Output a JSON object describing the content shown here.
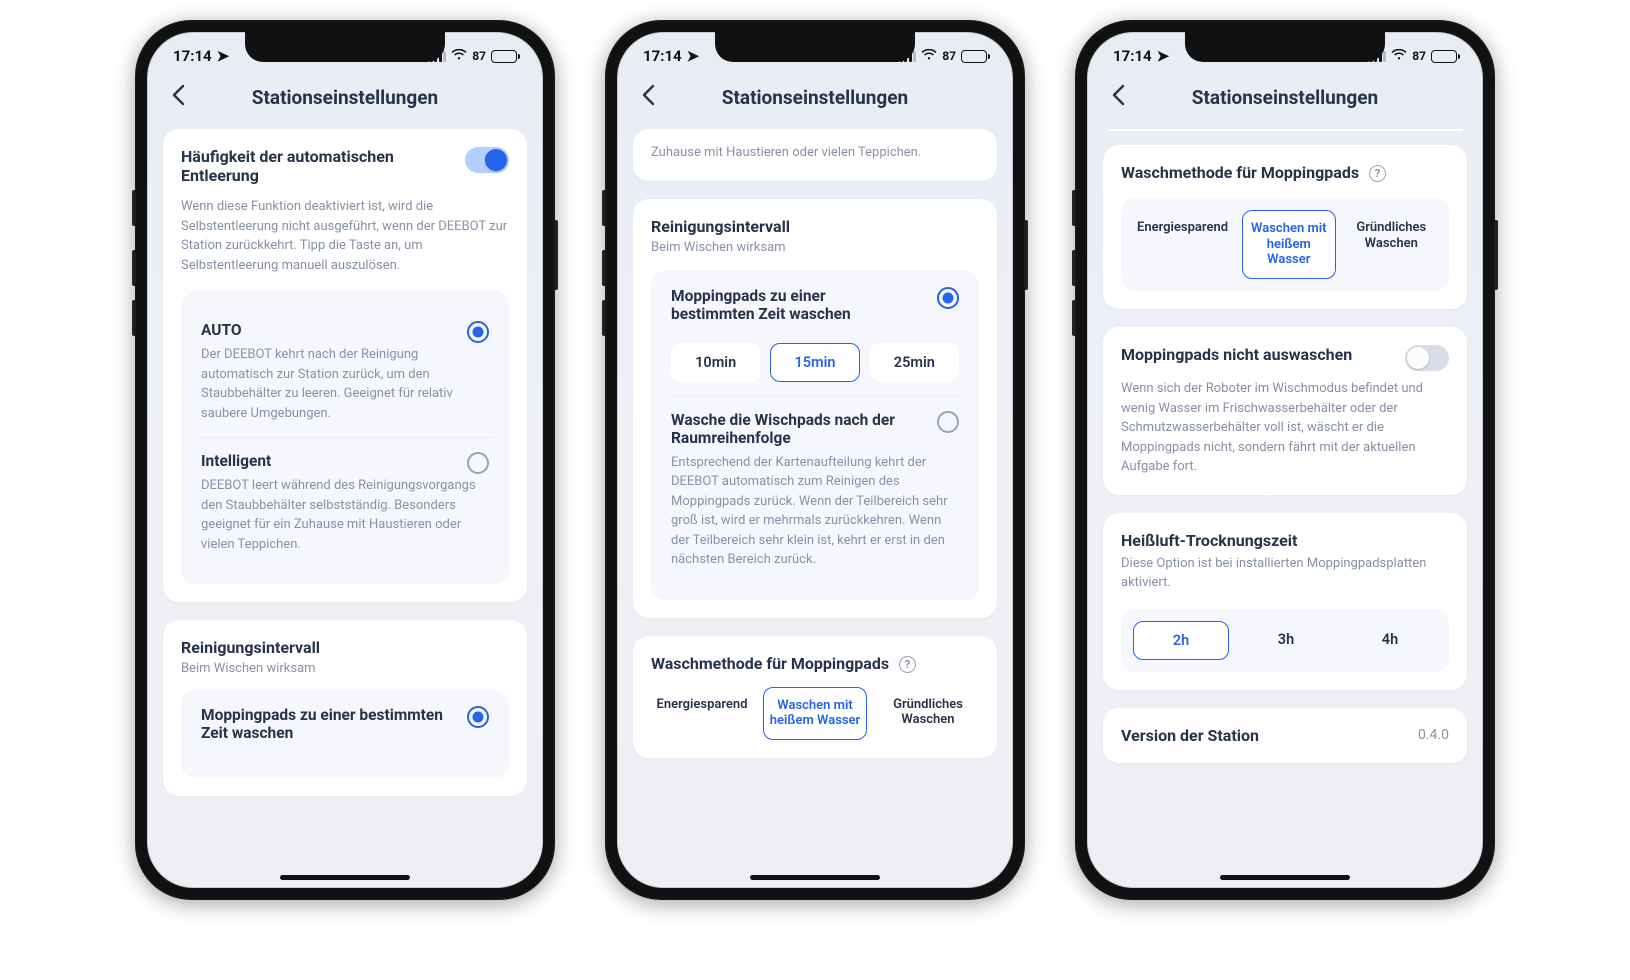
{
  "status": {
    "time": "17:14",
    "battery": "87"
  },
  "nav": {
    "title": "Stationseinstellungen"
  },
  "screen1": {
    "autoEmpty": {
      "title": "Häufigkeit der automatischen Entleerung",
      "desc": "Wenn diese Funktion deaktiviert ist, wird die Selbstentleerung nicht ausgeführt, wenn der DEEBOT zur Station zurückkehrt. Tipp die Taste an, um Selbstentleerung manuell auszulösen.",
      "optAuto": {
        "title": "AUTO",
        "desc": "Der DEEBOT kehrt nach der Reinigung automatisch zur Station zurück, um den Staubbehälter zu leeren. Geeignet für relativ saubere Umgebungen."
      },
      "optIntel": {
        "title": "Intelligent",
        "desc": "DEEBOT leert während des Reinigungsvorgangs den Staubbehälter selbstständig. Besonders geeignet für ein Zuhause mit Haustieren oder vielen Teppichen."
      }
    },
    "cleanInterval": {
      "title": "Reinigungsintervall",
      "sub": "Beim Wischen wirksam",
      "mopTime": "Moppingpads zu einer bestimmten Zeit waschen"
    }
  },
  "screen2": {
    "trailingText": "Zuhause mit Haustieren oder vielen Teppichen.",
    "cleanInterval": {
      "title": "Reinigungsintervall",
      "sub": "Beim Wischen wirksam",
      "opt1": "Moppingpads zu einer bestimmten Zeit waschen",
      "times": {
        "a": "10min",
        "b": "15min",
        "c": "25min"
      },
      "opt2": "Wasche die Wischpads nach der Raumreihenfolge",
      "opt2desc": "Entsprechend der Kartenaufteilung kehrt der DEEBOT automatisch zum Reinigen des Moppingpads zurück. Wenn der Teilbereich sehr groß ist, wird er mehrmals zurückkehren. Wenn der Teilbereich sehr klein ist, kehrt er erst in den nächsten Bereich zurück."
    },
    "washMethod": {
      "title": "Waschmethode für Moppingpads",
      "a": "Energiesparend",
      "b": "Waschen mit heißem Wasser",
      "c": "Gründliches Waschen"
    }
  },
  "screen3": {
    "washMethod": {
      "title": "Waschmethode für Moppingpads",
      "a": "Energiesparend",
      "b": "Waschen mit heißem Wasser",
      "c": "Gründliches Waschen"
    },
    "noRinse": {
      "title": "Moppingpads nicht auswaschen",
      "desc": "Wenn sich der Roboter im Wischmodus befindet und wenig Wasser im Frischwasserbehälter oder der Schmutzwasserbehälter voll ist, wäscht er die Moppingpads nicht, sondern fährt mit der aktuellen Aufgabe fort."
    },
    "hotAir": {
      "title": "Heißluft-Trocknungszeit",
      "sub": "Diese Option ist bei installierten Moppingpadsplatten aktiviert.",
      "a": "2h",
      "b": "3h",
      "c": "4h"
    },
    "version": {
      "label": "Version der Station",
      "value": "0.4.0"
    }
  }
}
